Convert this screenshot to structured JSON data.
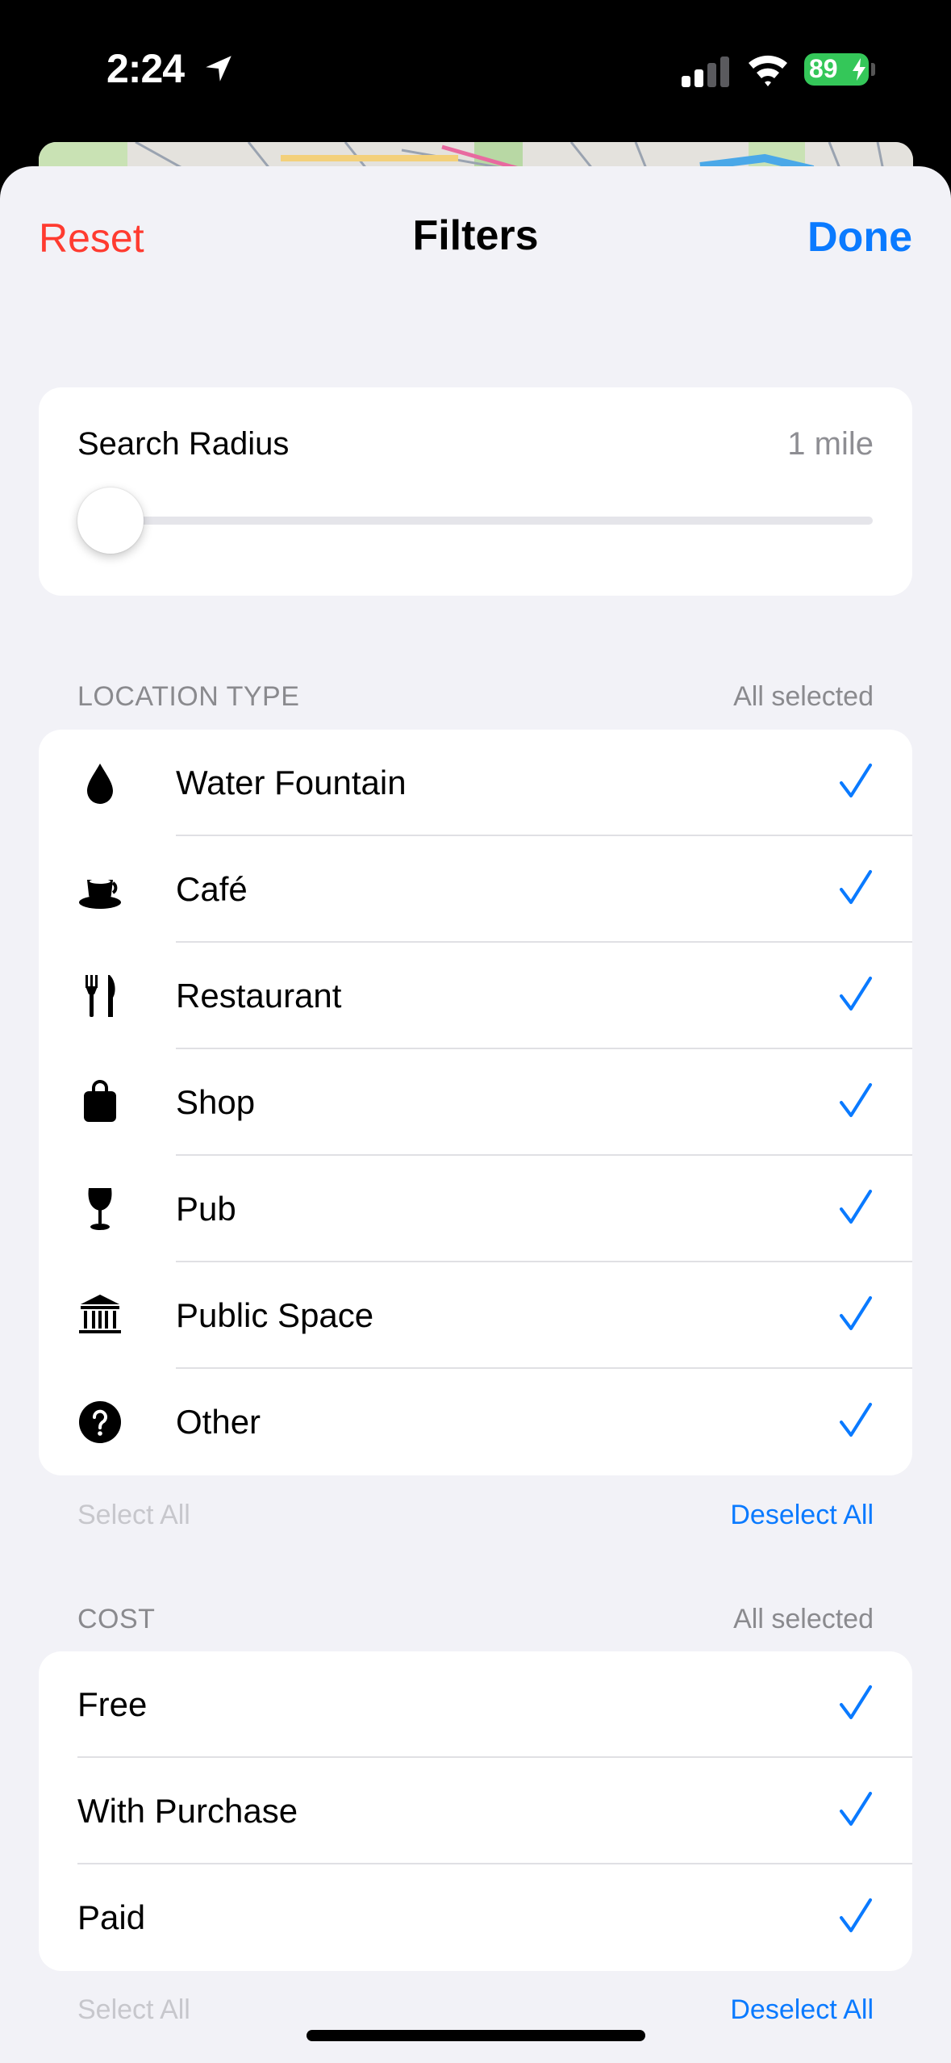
{
  "status_bar": {
    "time": "2:24",
    "battery": "89",
    "icons": [
      "location-arrow-icon",
      "cellular-signal-icon",
      "wifi-icon",
      "battery-charging-icon"
    ]
  },
  "nav": {
    "reset_label": "Reset",
    "title": "Filters",
    "done_label": "Done"
  },
  "search_radius": {
    "label": "Search Radius",
    "value": "1 mile",
    "slider_level": 0
  },
  "location_type": {
    "header": "LOCATION TYPE",
    "status": "All selected",
    "items": [
      {
        "label": "Water Fountain",
        "icon": "water-drop-icon",
        "checked": true
      },
      {
        "label": "Café",
        "icon": "coffee-cup-icon",
        "checked": true
      },
      {
        "label": "Restaurant",
        "icon": "fork-knife-icon",
        "checked": true
      },
      {
        "label": "Shop",
        "icon": "shopping-bag-icon",
        "checked": true
      },
      {
        "label": "Pub",
        "icon": "wine-glass-icon",
        "checked": true
      },
      {
        "label": "Public Space",
        "icon": "building-columns-icon",
        "checked": true
      },
      {
        "label": "Other",
        "icon": "question-circle-icon",
        "checked": true
      }
    ],
    "select_all_label": "Select All",
    "deselect_all_label": "Deselect All"
  },
  "cost": {
    "header": "COST",
    "status": "All selected",
    "items": [
      {
        "label": "Free",
        "checked": true
      },
      {
        "label": "With Purchase",
        "checked": true
      },
      {
        "label": "Paid",
        "checked": true
      }
    ],
    "select_all_label": "Select All",
    "deselect_all_label": "Deselect All"
  },
  "colors": {
    "accent": "#0a7aff",
    "destructive": "#ff3b30",
    "battery": "#34c759",
    "background": "#f2f2f7"
  }
}
